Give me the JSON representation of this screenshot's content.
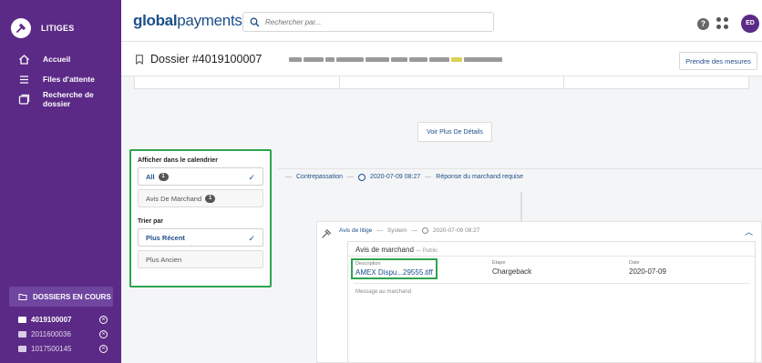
{
  "sidebar": {
    "brand": "LITIGES",
    "nav": [
      {
        "label": "Accueil",
        "icon": "home-icon"
      },
      {
        "label": "Files d'attente",
        "icon": "list-icon"
      },
      {
        "label": "Recherche de dossier",
        "icon": "folder-search-icon"
      }
    ],
    "cases_header": "DOSSIERS EN COURS",
    "cases": [
      {
        "number": "4019100007",
        "active": true
      },
      {
        "number": "2011600036",
        "active": false
      },
      {
        "number": "1017500145",
        "active": false
      }
    ]
  },
  "topbar": {
    "logo_bold": "global",
    "logo_light": "payments",
    "search_placeholder": "Rechercher par...",
    "help": "?",
    "avatar": "ED"
  },
  "dossier": {
    "title": "Dossier #4019100007",
    "take_action": "Prendre des mesures"
  },
  "more_details": "Voir Plus De Détails",
  "filter": {
    "calendar_label": "Afficher dans le calendrier",
    "options": [
      {
        "label": "All",
        "count": "1",
        "selected": true
      },
      {
        "label": "Avis De Marchand",
        "count": "1",
        "selected": false
      }
    ],
    "sort_label": "Trier par",
    "sort_options": [
      {
        "label": "Plus Récent",
        "selected": true
      },
      {
        "label": "Plus Ancien",
        "selected": false
      }
    ],
    "check": "✓"
  },
  "timeline": {
    "event_type": "Contrepassation",
    "sep": "—",
    "timestamp": "2020-07-09 08:27",
    "status": "Réponse du marchand requise"
  },
  "event": {
    "type": "Avis de litige",
    "source": "System",
    "timestamp": "2020-07-09 08:27",
    "card_title": "Avis de marchand",
    "card_sub": "— Public",
    "description_label": "Description",
    "description_value": "AMEX Dispu...29555.tiff",
    "step_label": "Étape",
    "step_value": "Chargeback",
    "date_label": "Date",
    "date_value": "2020-07-09",
    "message_label": "Message au marchand"
  }
}
